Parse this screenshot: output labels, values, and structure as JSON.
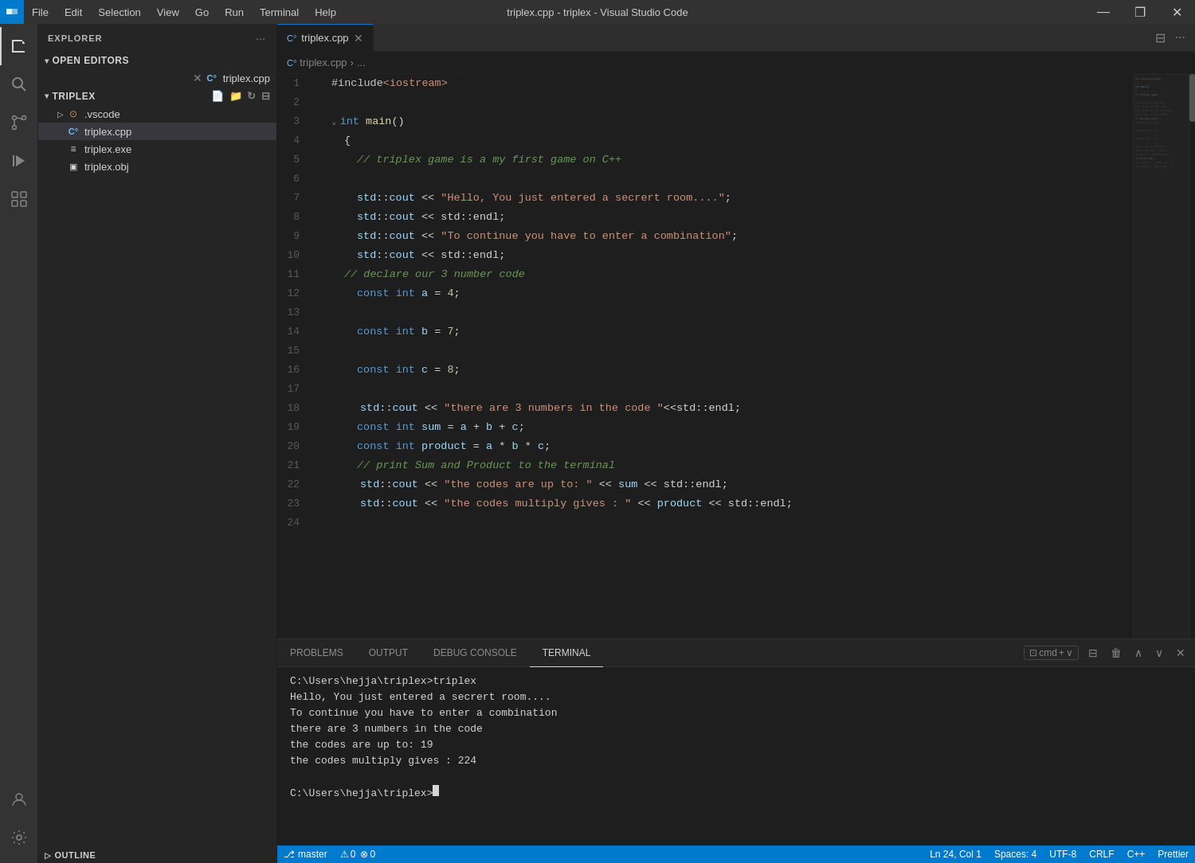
{
  "titlebar": {
    "app_icon": "⬡",
    "menu_items": [
      "File",
      "Edit",
      "Selection",
      "View",
      "Go",
      "Run",
      "Terminal",
      "Help"
    ],
    "title": "triplex.cpp - triplex - Visual Studio Code",
    "controls": [
      "—",
      "❐",
      "✕"
    ]
  },
  "activity_bar": {
    "icons": [
      {
        "name": "explorer-icon",
        "symbol": "⎘",
        "active": true
      },
      {
        "name": "search-icon",
        "symbol": "🔍",
        "active": false
      },
      {
        "name": "source-control-icon",
        "symbol": "⎇",
        "active": false
      },
      {
        "name": "run-icon",
        "symbol": "▷",
        "active": false
      },
      {
        "name": "extensions-icon",
        "symbol": "⊞",
        "active": false
      }
    ],
    "bottom_icons": [
      {
        "name": "account-icon",
        "symbol": "👤"
      },
      {
        "name": "settings-icon",
        "symbol": "⚙"
      }
    ]
  },
  "sidebar": {
    "header": "EXPLORER",
    "header_more": "···",
    "sections": {
      "open_editors": {
        "label": "OPEN EDITORS",
        "files": [
          {
            "name": "triplex.cpp",
            "icon": "C°",
            "icon_color": "#75beff",
            "active": true
          }
        ]
      },
      "triplex": {
        "label": "TRIPLEX",
        "action_icons": [
          "new_file",
          "new_folder",
          "refresh",
          "collapse"
        ],
        "items": [
          {
            "name": ".vscode",
            "type": "folder",
            "icon": "▷",
            "indent": 1
          },
          {
            "name": "triplex.cpp",
            "icon": "C°",
            "icon_color": "#75beff",
            "indent": 2,
            "active": true
          },
          {
            "name": "triplex.exe",
            "icon": "≡",
            "indent": 2
          },
          {
            "name": "triplex.obj",
            "icon": "▣",
            "indent": 2
          }
        ]
      }
    },
    "outline": {
      "label": "OUTLINE"
    }
  },
  "editor": {
    "tab_label": "triplex.cpp",
    "tab_icon": "C°",
    "breadcrumb": [
      "triplex.cpp",
      "..."
    ],
    "lines": [
      {
        "num": 1,
        "tokens": [
          {
            "text": "#include",
            "cls": "macro"
          },
          {
            "text": "<iostream>",
            "cls": "inc"
          }
        ]
      },
      {
        "num": 2,
        "tokens": []
      },
      {
        "num": 3,
        "tokens": [
          {
            "text": "  int ",
            "cls": "kw"
          },
          {
            "text": "main",
            "cls": "fn"
          },
          {
            "text": "()",
            "cls": ""
          }
        ],
        "fold": true
      },
      {
        "num": 4,
        "tokens": [
          {
            "text": "    {",
            "cls": ""
          }
        ]
      },
      {
        "num": 5,
        "tokens": [
          {
            "text": "        // triplex game is a my first game on C++",
            "cls": "cmt"
          }
        ]
      },
      {
        "num": 6,
        "tokens": []
      },
      {
        "num": 7,
        "tokens": [
          {
            "text": "        std::cout ",
            "cls": ""
          },
          {
            "text": "<<",
            "cls": "op"
          },
          {
            "text": " \"Hello, You just entered a secrert room....\"",
            "cls": "str"
          },
          {
            "text": ";",
            "cls": ""
          }
        ]
      },
      {
        "num": 8,
        "tokens": [
          {
            "text": "        std::cout ",
            "cls": ""
          },
          {
            "text": "<<",
            "cls": "op"
          },
          {
            "text": " std::endl",
            "cls": ""
          },
          {
            "text": ";",
            "cls": ""
          }
        ]
      },
      {
        "num": 9,
        "tokens": [
          {
            "text": "        std::cout ",
            "cls": ""
          },
          {
            "text": "<<",
            "cls": "op"
          },
          {
            "text": " \"To continue you have to enter a combination\"",
            "cls": "str"
          },
          {
            "text": ";",
            "cls": ""
          }
        ]
      },
      {
        "num": 10,
        "tokens": [
          {
            "text": "        std::cout ",
            "cls": ""
          },
          {
            "text": "<<",
            "cls": "op"
          },
          {
            "text": " std::endl",
            "cls": ""
          },
          {
            "text": ";",
            "cls": ""
          }
        ]
      },
      {
        "num": 11,
        "tokens": [
          {
            "text": "        // declare our 3 number code",
            "cls": "cmt"
          }
        ]
      },
      {
        "num": 12,
        "tokens": [
          {
            "text": "        ",
            "cls": ""
          },
          {
            "text": "const",
            "cls": "kw"
          },
          {
            "text": " ",
            "cls": ""
          },
          {
            "text": "int",
            "cls": "kw"
          },
          {
            "text": " ",
            "cls": ""
          },
          {
            "text": "a",
            "cls": "var"
          },
          {
            "text": " = ",
            "cls": ""
          },
          {
            "text": "4",
            "cls": "num"
          },
          {
            "text": ";",
            "cls": ""
          }
        ]
      },
      {
        "num": 13,
        "tokens": []
      },
      {
        "num": 14,
        "tokens": [
          {
            "text": "        ",
            "cls": ""
          },
          {
            "text": "const",
            "cls": "kw"
          },
          {
            "text": " ",
            "cls": ""
          },
          {
            "text": "int",
            "cls": "kw"
          },
          {
            "text": " ",
            "cls": ""
          },
          {
            "text": "b",
            "cls": "var"
          },
          {
            "text": " = ",
            "cls": ""
          },
          {
            "text": "7",
            "cls": "num"
          },
          {
            "text": ";",
            "cls": ""
          }
        ]
      },
      {
        "num": 15,
        "tokens": []
      },
      {
        "num": 16,
        "tokens": [
          {
            "text": "        ",
            "cls": ""
          },
          {
            "text": "const",
            "cls": "kw"
          },
          {
            "text": " ",
            "cls": ""
          },
          {
            "text": "int",
            "cls": "kw"
          },
          {
            "text": " ",
            "cls": ""
          },
          {
            "text": "c",
            "cls": "var"
          },
          {
            "text": " = ",
            "cls": ""
          },
          {
            "text": "8",
            "cls": "num"
          },
          {
            "text": ";",
            "cls": ""
          }
        ]
      },
      {
        "num": 17,
        "tokens": []
      },
      {
        "num": 18,
        "tokens": [
          {
            "text": "         std::cout ",
            "cls": ""
          },
          {
            "text": "<<",
            "cls": "op"
          },
          {
            "text": " \"there are 3 numbers in the code \"",
            "cls": "str"
          },
          {
            "text": "<<std::endl;",
            "cls": ""
          }
        ]
      },
      {
        "num": 19,
        "tokens": [
          {
            "text": "        ",
            "cls": ""
          },
          {
            "text": "const",
            "cls": "kw"
          },
          {
            "text": " ",
            "cls": ""
          },
          {
            "text": "int",
            "cls": "kw"
          },
          {
            "text": " ",
            "cls": ""
          },
          {
            "text": "sum",
            "cls": "var"
          },
          {
            "text": " = ",
            "cls": ""
          },
          {
            "text": "a",
            "cls": "var"
          },
          {
            "text": " + ",
            "cls": ""
          },
          {
            "text": "b",
            "cls": "var"
          },
          {
            "text": " + ",
            "cls": ""
          },
          {
            "text": "c",
            "cls": "var"
          },
          {
            "text": ";",
            "cls": ""
          }
        ]
      },
      {
        "num": 20,
        "tokens": [
          {
            "text": "        ",
            "cls": ""
          },
          {
            "text": "const",
            "cls": "kw"
          },
          {
            "text": " ",
            "cls": ""
          },
          {
            "text": "int",
            "cls": "kw"
          },
          {
            "text": " ",
            "cls": ""
          },
          {
            "text": "product",
            "cls": "var"
          },
          {
            "text": " = ",
            "cls": ""
          },
          {
            "text": "a",
            "cls": "var"
          },
          {
            "text": " * ",
            "cls": ""
          },
          {
            "text": "b",
            "cls": "var"
          },
          {
            "text": " * ",
            "cls": ""
          },
          {
            "text": "c",
            "cls": "var"
          },
          {
            "text": ";",
            "cls": ""
          }
        ]
      },
      {
        "num": 21,
        "tokens": [
          {
            "text": "        // print Sum and Product to the terminal",
            "cls": "cmt"
          }
        ]
      },
      {
        "num": 22,
        "tokens": [
          {
            "text": "         std::cout ",
            "cls": ""
          },
          {
            "text": "<<",
            "cls": "op"
          },
          {
            "text": " \"the codes are up to: \"",
            "cls": "str"
          },
          {
            "text": " << ",
            "cls": ""
          },
          {
            "text": "sum",
            "cls": "var"
          },
          {
            "text": " << std::endl;",
            "cls": ""
          }
        ]
      },
      {
        "num": 23,
        "tokens": [
          {
            "text": "         std::cout ",
            "cls": ""
          },
          {
            "text": "<<",
            "cls": "op"
          },
          {
            "text": " \"the codes multiply gives : \"",
            "cls": "str"
          },
          {
            "text": " << ",
            "cls": ""
          },
          {
            "text": "product",
            "cls": "var"
          },
          {
            "text": " << std::endl;",
            "cls": ""
          }
        ]
      },
      {
        "num": 24,
        "tokens": []
      }
    ]
  },
  "panel": {
    "tabs": [
      "PROBLEMS",
      "OUTPUT",
      "DEBUG CONSOLE",
      "TERMINAL"
    ],
    "active_tab": "TERMINAL",
    "terminal_lines": [
      "C:\\Users\\hejja\\triplex>triplex",
      "Hello, You just entered a secrert room....",
      "To continue you have to enter a combination",
      "there are 3 numbers in the code",
      "the codes are up to: 19",
      "the codes multiply gives : 224",
      "",
      "C:\\Users\\hejja\\triplex>"
    ],
    "actions": {
      "new_terminal": "+",
      "split": "⊟",
      "trash": "🗑",
      "up": "∧",
      "down": "∨",
      "close": "✕",
      "cmd_label": "cmd"
    }
  },
  "status_bar": {
    "left_items": [
      "⎇ master",
      "⚠ 0",
      "⊗ 0"
    ],
    "right_items": [
      "Ln 24, Col 1",
      "Spaces: 4",
      "UTF-8",
      "CRLF",
      "C++",
      "Prettier"
    ]
  }
}
